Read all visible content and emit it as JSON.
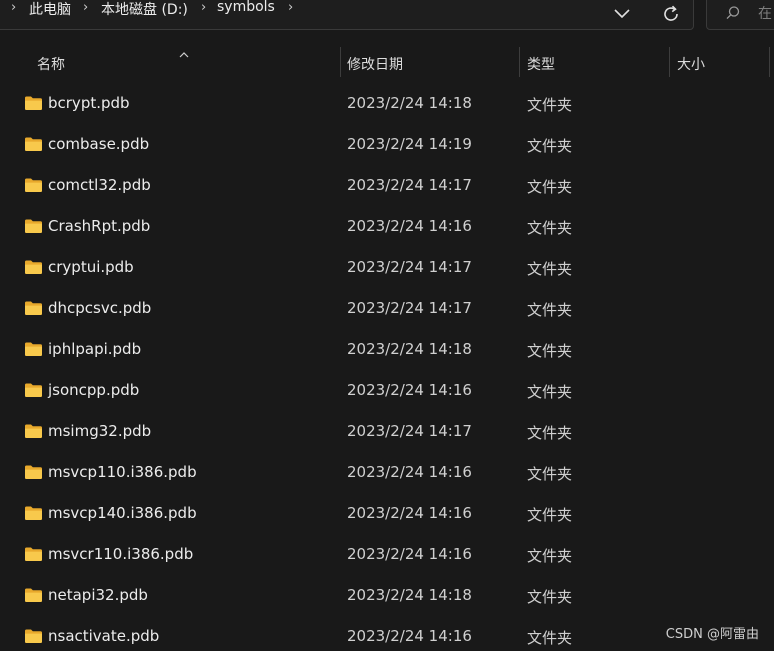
{
  "address_bar": {
    "breadcrumb": [
      "此电脑",
      "本地磁盘 (D:)",
      "symbols"
    ],
    "search_placeholder": "在"
  },
  "columns": {
    "name": "名称",
    "modified": "修改日期",
    "type": "类型",
    "size": "大小"
  },
  "files": [
    {
      "name": "bcrypt.pdb",
      "modified": "2023/2/24 14:18",
      "type": "文件夹",
      "size": ""
    },
    {
      "name": "combase.pdb",
      "modified": "2023/2/24 14:19",
      "type": "文件夹",
      "size": ""
    },
    {
      "name": "comctl32.pdb",
      "modified": "2023/2/24 14:17",
      "type": "文件夹",
      "size": ""
    },
    {
      "name": "CrashRpt.pdb",
      "modified": "2023/2/24 14:16",
      "type": "文件夹",
      "size": ""
    },
    {
      "name": "cryptui.pdb",
      "modified": "2023/2/24 14:17",
      "type": "文件夹",
      "size": ""
    },
    {
      "name": "dhcpcsvc.pdb",
      "modified": "2023/2/24 14:17",
      "type": "文件夹",
      "size": ""
    },
    {
      "name": "iphlpapi.pdb",
      "modified": "2023/2/24 14:18",
      "type": "文件夹",
      "size": ""
    },
    {
      "name": "jsoncpp.pdb",
      "modified": "2023/2/24 14:16",
      "type": "文件夹",
      "size": ""
    },
    {
      "name": "msimg32.pdb",
      "modified": "2023/2/24 14:17",
      "type": "文件夹",
      "size": ""
    },
    {
      "name": "msvcp110.i386.pdb",
      "modified": "2023/2/24 14:16",
      "type": "文件夹",
      "size": ""
    },
    {
      "name": "msvcp140.i386.pdb",
      "modified": "2023/2/24 14:16",
      "type": "文件夹",
      "size": ""
    },
    {
      "name": "msvcr110.i386.pdb",
      "modified": "2023/2/24 14:16",
      "type": "文件夹",
      "size": ""
    },
    {
      "name": "netapi32.pdb",
      "modified": "2023/2/24 14:18",
      "type": "文件夹",
      "size": ""
    },
    {
      "name": "nsactivate.pdb",
      "modified": "2023/2/24 14:16",
      "type": "文件夹",
      "size": ""
    }
  ],
  "watermark": "CSDN @阿雷由",
  "colors": {
    "background": "#191919",
    "folder": "#f6c342",
    "text": "#ececec",
    "divider": "#3d3d3d"
  },
  "icons": {
    "folder": "folder-icon",
    "breadcrumb_separator": "chevron-right-icon",
    "history": "chevron-down-icon",
    "refresh": "refresh-icon",
    "search": "search-icon",
    "sort": "sort-ascending-icon"
  }
}
